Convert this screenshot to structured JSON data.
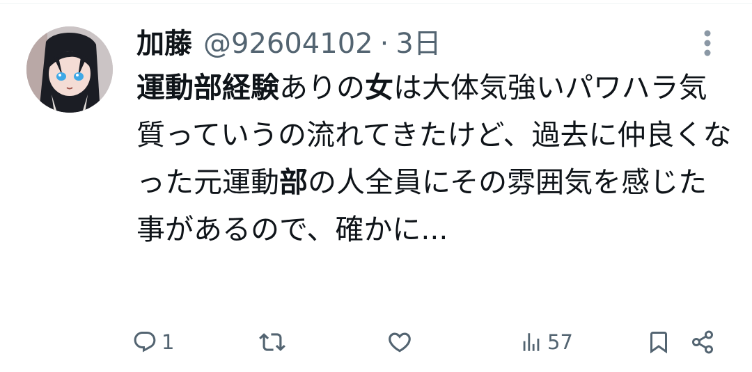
{
  "tweet": {
    "author": {
      "display_name": "加藤",
      "handle": "@92604102",
      "avatar_icon": "anime-character-avatar"
    },
    "separator": "·",
    "time": "3日",
    "text_segments": [
      {
        "text": "運動部経験",
        "bold": true
      },
      {
        "text": "ありの",
        "bold": false
      },
      {
        "text": "女",
        "bold": true
      },
      {
        "text": "は大体気強いパワハラ気質っていうの流れてきたけど、過去に仲良くなった元運動",
        "bold": false
      },
      {
        "text": "部",
        "bold": true
      },
      {
        "text": "の人全員にその雰囲気を感じた事があるので、確かに...",
        "bold": false
      }
    ]
  },
  "actions": {
    "reply": {
      "icon": "reply-icon",
      "count": "1"
    },
    "retweet": {
      "icon": "retweet-icon"
    },
    "like": {
      "icon": "heart-icon"
    },
    "views": {
      "icon": "views-chart-icon",
      "count": "57"
    },
    "bookmark": {
      "icon": "bookmark-icon"
    },
    "share": {
      "icon": "share-icon"
    }
  },
  "colors": {
    "text_primary": "#0f1419",
    "text_secondary": "#536471",
    "divider": "#eff3f4",
    "more_dots": "#8b98a5"
  }
}
